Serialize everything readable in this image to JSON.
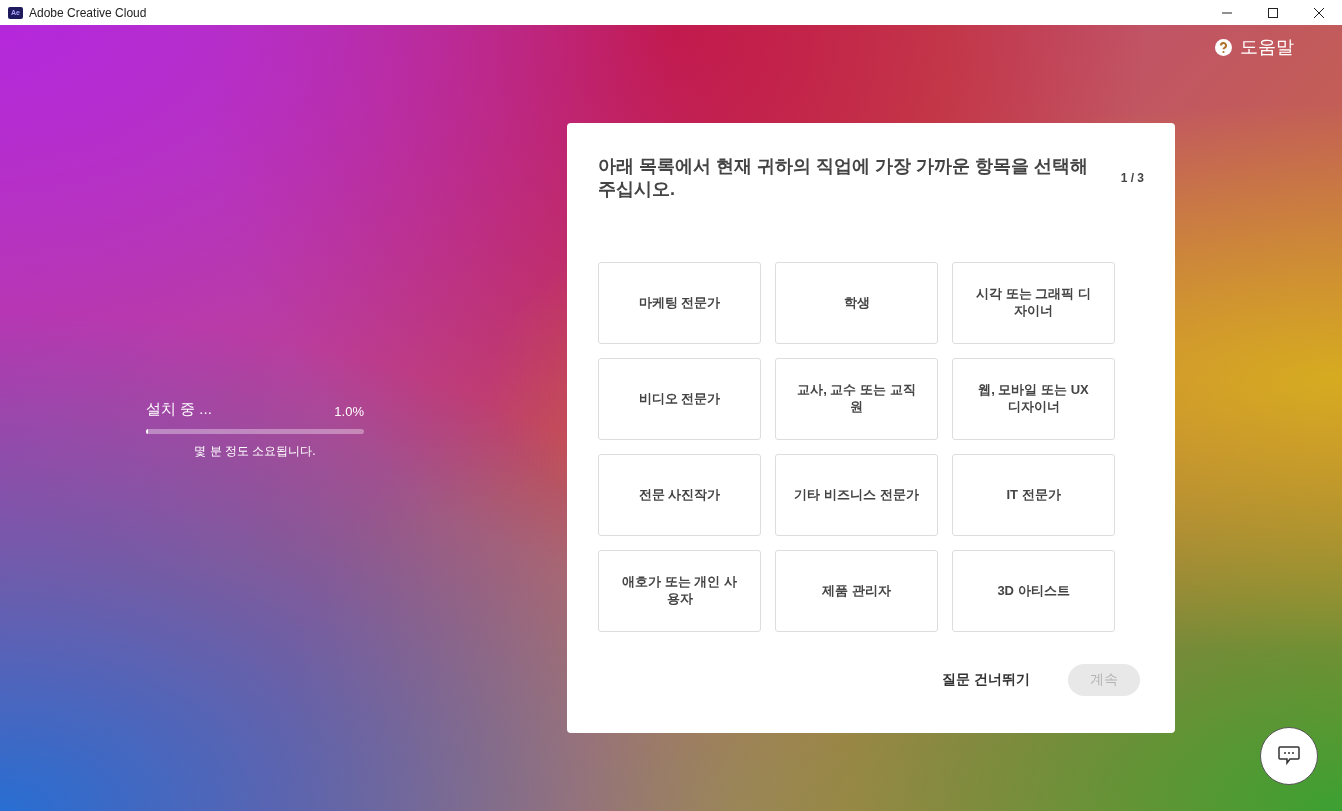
{
  "window": {
    "title": "Adobe Creative Cloud",
    "app_badge": "Ae"
  },
  "help": {
    "label": "도움말"
  },
  "install": {
    "status": "설치 중 ...",
    "percent": "1.0%",
    "level": 0.01,
    "note": "몇 분 정도 소요됩니다."
  },
  "survey": {
    "question": "아래 목록에서 현재 귀하의 직업에 가장 가까운 항목을 선택해 주십시오.",
    "step": "1 / 3",
    "options": [
      {
        "label": "마케팅 전문가",
        "selected": false
      },
      {
        "label": "학생",
        "selected": false
      },
      {
        "label": "시각 또는 그래픽 디자이너",
        "selected": false
      },
      {
        "label": "비디오 전문가",
        "selected": false
      },
      {
        "label": "교사, 교수 또는 교직원",
        "selected": false
      },
      {
        "label": "웹, 모바일 또는 UX 디자이너",
        "selected": false
      },
      {
        "label": "전문 사진작가",
        "selected": false
      },
      {
        "label": "기타 비즈니스 전문가",
        "selected": false
      },
      {
        "label": "IT 전문가",
        "selected": false
      },
      {
        "label": "애호가 또는 개인 사용자",
        "selected": false
      },
      {
        "label": "제품 관리자",
        "selected": false
      },
      {
        "label": "3D 아티스트",
        "selected": false
      }
    ],
    "skip": "질문 건너뛰기",
    "continue": {
      "label": "계속",
      "disabled": true
    }
  }
}
